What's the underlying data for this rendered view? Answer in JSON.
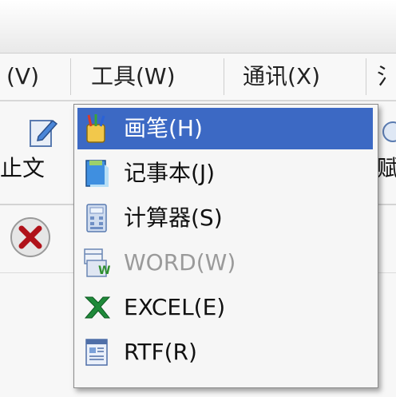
{
  "menubar": {
    "items": [
      {
        "label": "(V)"
      },
      {
        "label": "工具(W)"
      },
      {
        "label": "通讯(X)"
      },
      {
        "label": "氵"
      }
    ]
  },
  "toolbar": {
    "left_label": "止文",
    "right_label": "赋"
  },
  "tools_menu": {
    "items": [
      {
        "label": "画笔(H)",
        "icon": "paintbrush-icon",
        "enabled": true,
        "selected": true
      },
      {
        "label": "记事本(J)",
        "icon": "notepad-icon",
        "enabled": true,
        "selected": false
      },
      {
        "label": "计算器(S)",
        "icon": "calculator-icon",
        "enabled": true,
        "selected": false
      },
      {
        "label": "WORD(W)",
        "icon": "word-icon",
        "enabled": false,
        "selected": false
      },
      {
        "label": "EXCEL(E)",
        "icon": "excel-icon",
        "enabled": true,
        "selected": false
      },
      {
        "label": "RTF(R)",
        "icon": "rtf-icon",
        "enabled": true,
        "selected": false
      }
    ]
  },
  "colors": {
    "selection": "#3c69c4",
    "disabled_text": "#9a9a9a"
  }
}
